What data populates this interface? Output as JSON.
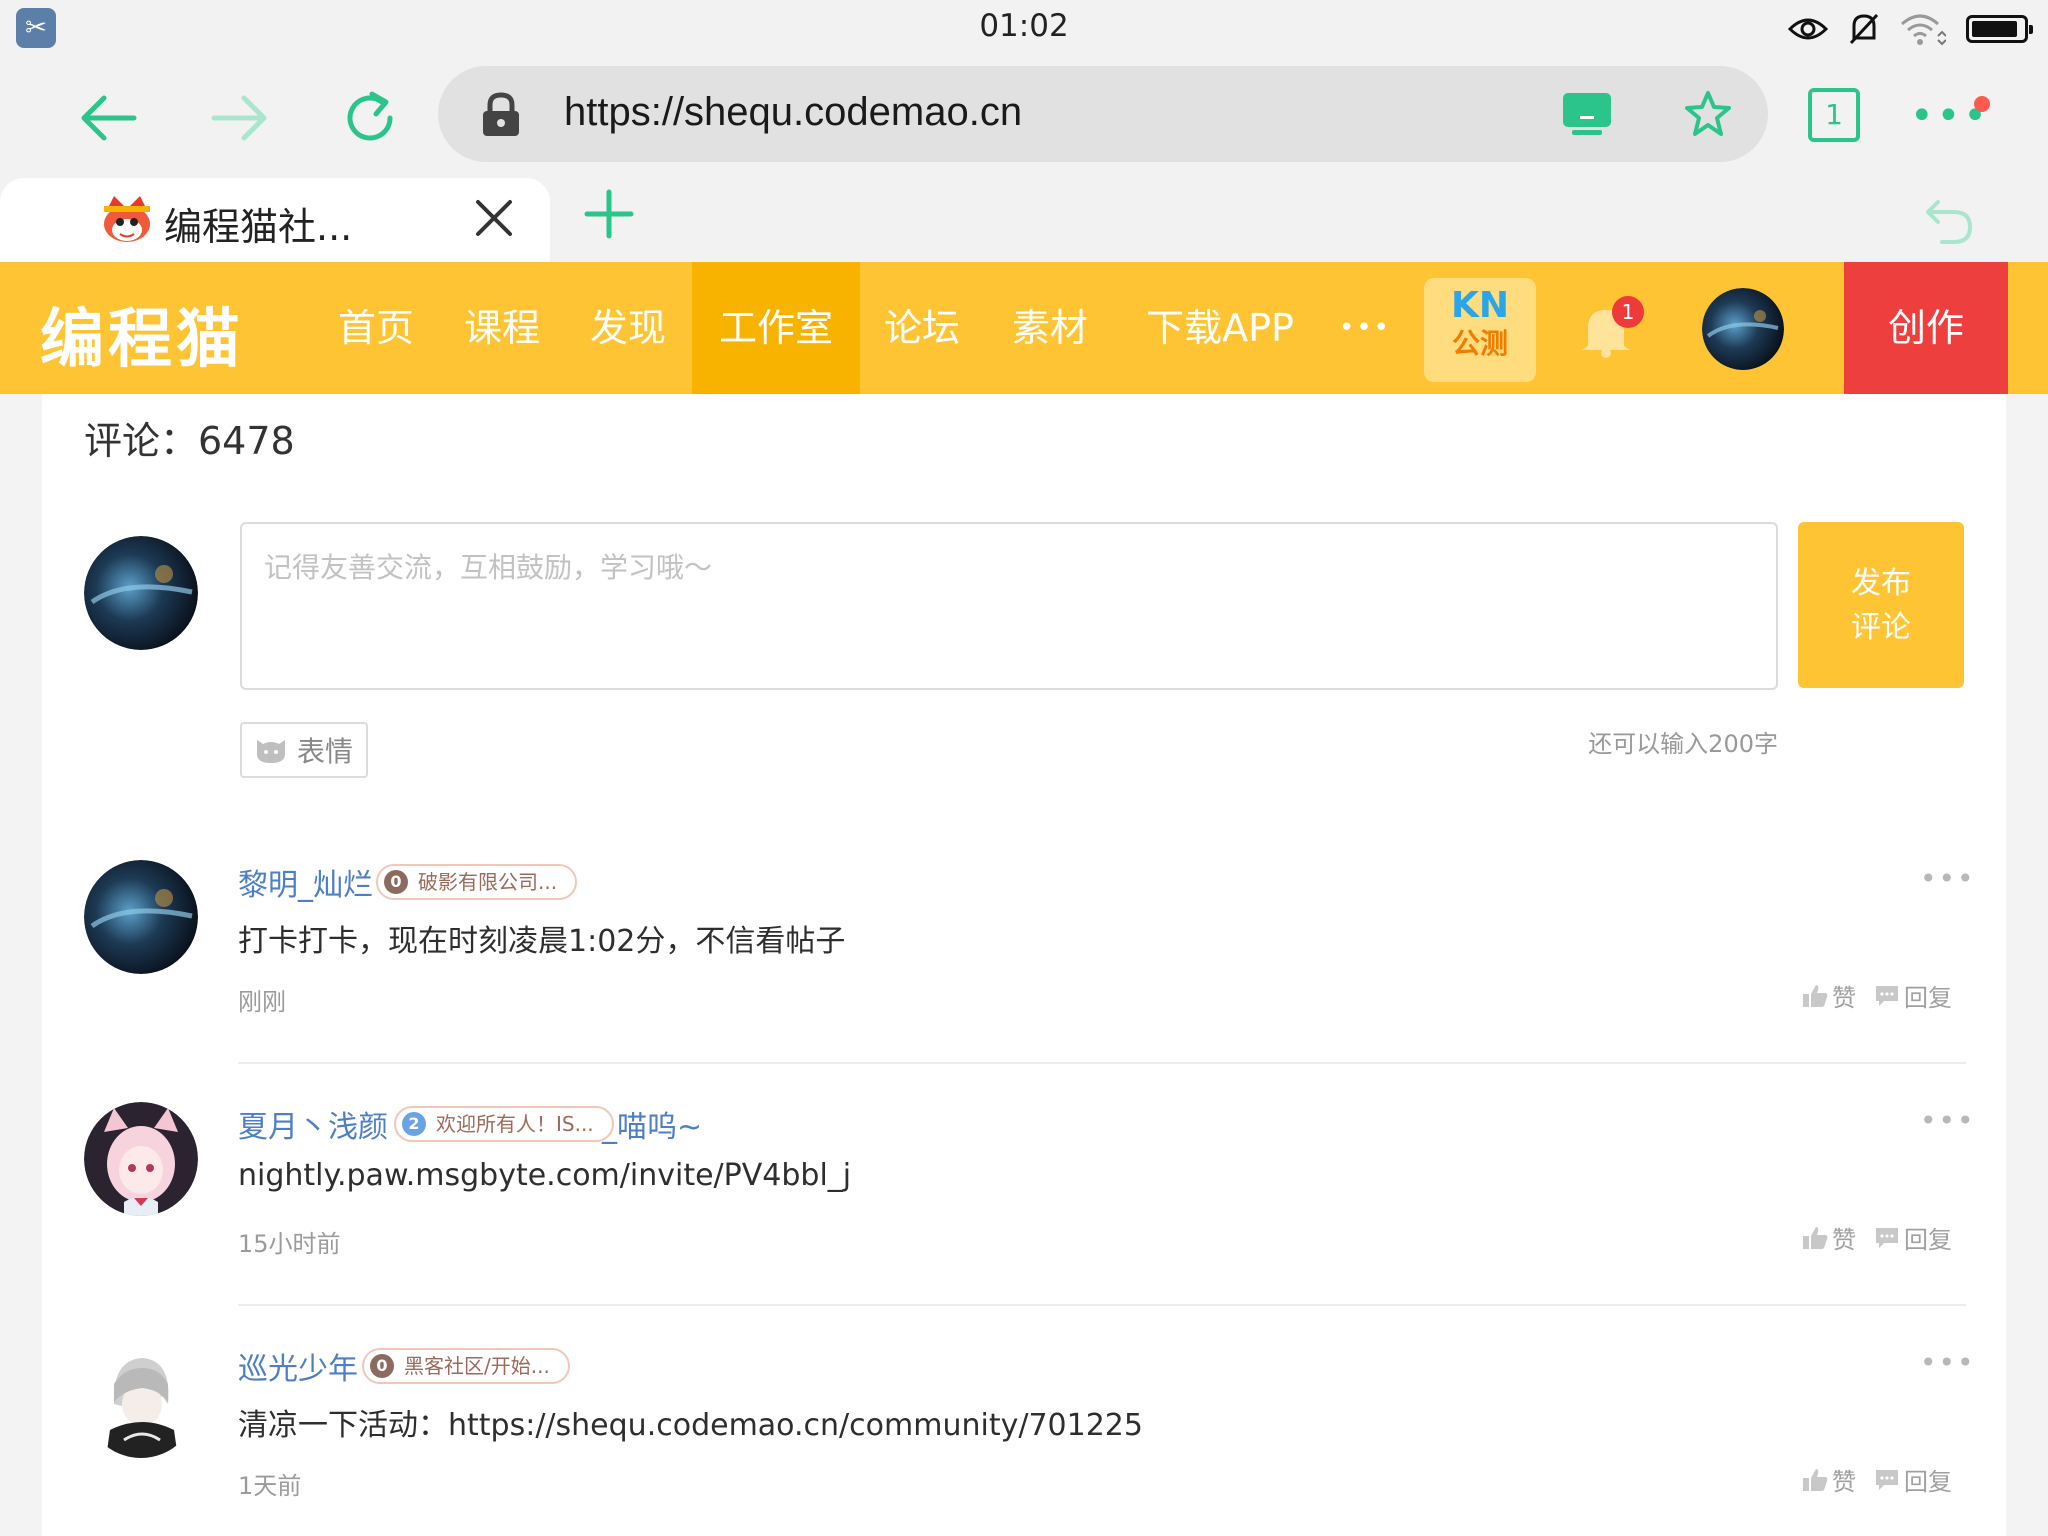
{
  "status_bar": {
    "time": "01:02",
    "icons": [
      "scissors-app-icon",
      "eye-icon",
      "mute-icon",
      "wifi-icon",
      "battery-icon"
    ],
    "battery_level": 0.9
  },
  "browser": {
    "url": "https://shequ.codemao.cn",
    "tab_count": "1",
    "tab_title": "编程猫社...",
    "colors": {
      "accent": "#2bc48a",
      "notify": "#ff5a4e"
    }
  },
  "site_nav": {
    "logo": "编程猫",
    "items": [
      {
        "label": "首页",
        "active": false
      },
      {
        "label": "课程",
        "active": false
      },
      {
        "label": "发现",
        "active": false
      },
      {
        "label": "工作室",
        "active": true
      },
      {
        "label": "论坛",
        "active": false
      },
      {
        "label": "素材",
        "active": false
      },
      {
        "label": "下载APP",
        "active": false
      }
    ],
    "more": "•••",
    "kn_line1": "KN",
    "kn_line2": "公测",
    "bell_badge": "1",
    "create_label": "创作",
    "colors": {
      "brand": "#fec433",
      "active": "#f8b300",
      "create": "#ee3f3f"
    }
  },
  "comments_section": {
    "count_label": "评论：6478",
    "input_placeholder": "记得友善交流，互相鼓励，学习哦～",
    "publish_line1": "发布",
    "publish_line2": "评论",
    "emoji_label": "表情",
    "remaining": "还可以输入200字",
    "like_label": "赞",
    "reply_label": "回复",
    "more": "•••",
    "items": [
      {
        "name": "黎明_灿烂",
        "badge_level": "0",
        "badge_text": "破影有限公司...",
        "name_suffix": "",
        "text": "打卡打卡，现在时刻凌晨1:02分，不信看帖子",
        "time": "刚刚"
      },
      {
        "name": "夏月丶浅颜",
        "badge_level": "2",
        "badge_text": "欢迎所有人！IS...",
        "name_suffix": "_喵呜~",
        "text": "nightly.paw.msgbyte.com/invite/PV4bbl_j",
        "time": "15小时前"
      },
      {
        "name": "巡光少年",
        "badge_level": "0",
        "badge_text": "黑客社区/开始...",
        "name_suffix": "",
        "text": "清凉一下活动：https://shequ.codemao.cn/community/701225",
        "time": "1天前"
      }
    ]
  }
}
